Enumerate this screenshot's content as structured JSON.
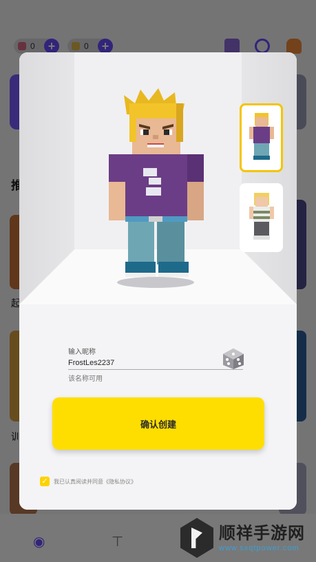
{
  "background": {
    "currencies": [
      {
        "value": "0",
        "icon": "heart-gem-icon",
        "color": "#d86a80"
      },
      {
        "value": "0",
        "icon": "gold-coin-icon",
        "color": "#e0b84a"
      }
    ],
    "section_title": "推",
    "labels": [
      "起",
      "训"
    ],
    "tabs": [
      {
        "icon": "game-controller-icon"
      },
      {
        "icon": "shirt-icon"
      }
    ]
  },
  "watermark": {
    "text": "顺祥手游网",
    "url": "www.sxqtpower.com"
  },
  "modal": {
    "nickname_label": "输入昵称",
    "nickname_value": "FrostLes2237",
    "nickname_status": "该名称可用",
    "confirm_label": "确认创建",
    "agreement_text": "我已认真阅读并同意《隐私协议》",
    "agreement_checked": true,
    "skins": [
      {
        "name": "skin-option-1",
        "selected": true
      },
      {
        "name": "skin-option-2",
        "selected": false
      }
    ]
  },
  "colors": {
    "accent_yellow": "#fede00",
    "accent_purple": "#6a4cff",
    "modal_bg": "#f4f4f6"
  }
}
